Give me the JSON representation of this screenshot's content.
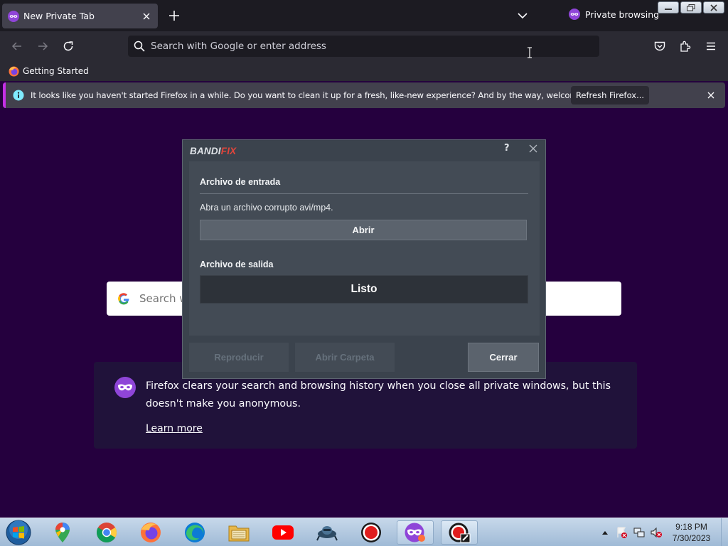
{
  "browser": {
    "tab": {
      "title": "New Private Tab"
    },
    "private_indicator": "Private browsing",
    "urlbar": {
      "placeholder": "Search with Google or enter address"
    },
    "bookmarks": [
      {
        "label": "Getting Started"
      }
    ]
  },
  "notification": {
    "text": "It looks like you haven't started Firefox in a while. Do you want to clean it up for a fresh, like-new experience? And by the way, welcome back!",
    "button": "Refresh Firefox..."
  },
  "private_page": {
    "search_placeholder": "Search w",
    "info_text": "Firefox clears your search and browsing history when you close all private windows, but this doesn't make you anonymous.",
    "learn_more": "Learn more"
  },
  "dialog": {
    "logo_part1": "BANDI",
    "logo_part2": "FIX",
    "help": "?",
    "input_section_title": "Archivo de entrada",
    "input_hint": "Abra un archivo corrupto avi/mp4.",
    "open_button": "Abrir",
    "output_section_title": "Archivo de salida",
    "output_status": "Listo",
    "buttons": {
      "play": "Reproducir",
      "open_folder": "Abrir Carpeta",
      "close": "Cerrar"
    }
  },
  "taskbar": {
    "pinned": [
      "google-maps",
      "chrome",
      "firefox",
      "edge",
      "file-explorer",
      "youtube",
      "spaceship-game",
      "recorder",
      "firefox-private",
      "bandifix"
    ],
    "clock_time": "9:18 PM",
    "clock_date": "7/30/2023"
  },
  "colors": {
    "page_background": "#25003e",
    "chrome_dark": "#1c1b22",
    "notification_accent": "#c52fe7",
    "bandifix_red": "#e2453b"
  }
}
